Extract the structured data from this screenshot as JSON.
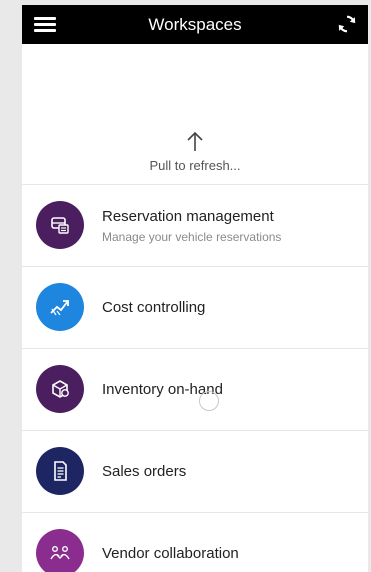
{
  "header": {
    "title": "Workspaces",
    "menu_icon": "hamburger-menu-icon",
    "refresh_icon": "sync-icon",
    "background": "#000000"
  },
  "pull_to_refresh": {
    "arrow_icon": "arrow-up-icon",
    "text": "Pull to refresh..."
  },
  "workspaces": [
    {
      "title": "Reservation management",
      "subtitle": "Manage your vehicle reservations",
      "icon": "car-reservation-icon",
      "color": "#4b1f5f"
    },
    {
      "title": "Cost controlling",
      "subtitle": "",
      "icon": "cost-chart-icon",
      "color": "#1f86e0"
    },
    {
      "title": "Inventory on-hand",
      "subtitle": "",
      "icon": "inventory-box-icon",
      "color": "#4b1f5f"
    },
    {
      "title": "Sales orders",
      "subtitle": "",
      "icon": "sales-document-icon",
      "color": "#1e2563"
    },
    {
      "title": "Vendor collaboration",
      "subtitle": "",
      "icon": "vendor-people-icon",
      "color": "#8b2d8f"
    }
  ]
}
